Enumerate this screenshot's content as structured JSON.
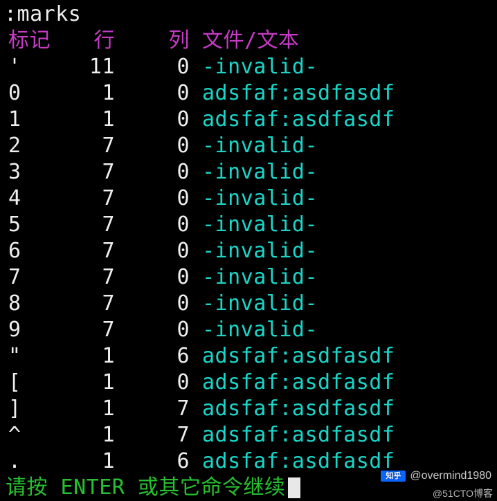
{
  "command": ":marks",
  "headers": {
    "mark": "标记",
    "line": "行",
    "col": "列",
    "file": "文件/文本"
  },
  "rows": [
    {
      "mark": "'",
      "line": "11",
      "col": "0",
      "file": "-invalid-"
    },
    {
      "mark": "0",
      "line": "1",
      "col": "0",
      "file": "adsfaf:asdfasdf"
    },
    {
      "mark": "1",
      "line": "1",
      "col": "0",
      "file": "adsfaf:asdfasdf"
    },
    {
      "mark": "2",
      "line": "7",
      "col": "0",
      "file": "-invalid-"
    },
    {
      "mark": "3",
      "line": "7",
      "col": "0",
      "file": "-invalid-"
    },
    {
      "mark": "4",
      "line": "7",
      "col": "0",
      "file": "-invalid-"
    },
    {
      "mark": "5",
      "line": "7",
      "col": "0",
      "file": "-invalid-"
    },
    {
      "mark": "6",
      "line": "7",
      "col": "0",
      "file": "-invalid-"
    },
    {
      "mark": "7",
      "line": "7",
      "col": "0",
      "file": "-invalid-"
    },
    {
      "mark": "8",
      "line": "7",
      "col": "0",
      "file": "-invalid-"
    },
    {
      "mark": "9",
      "line": "7",
      "col": "0",
      "file": "-invalid-"
    },
    {
      "mark": "\"",
      "line": "1",
      "col": "6",
      "file": "adsfaf:asdfasdf"
    },
    {
      "mark": "[",
      "line": "1",
      "col": "0",
      "file": "adsfaf:asdfasdf"
    },
    {
      "mark": "]",
      "line": "1",
      "col": "7",
      "file": "adsfaf:asdfasdf"
    },
    {
      "mark": "^",
      "line": "1",
      "col": "7",
      "file": "adsfaf:asdfasdf"
    },
    {
      "mark": ".",
      "line": "1",
      "col": "6",
      "file": "adsfaf:asdfasdf"
    }
  ],
  "prompt": "请按 ENTER 或其它命令继续",
  "watermarks": {
    "zhihu_logo": "知乎",
    "zhihu_user": "@overmind1980",
    "cto": "@51CTO博客"
  }
}
